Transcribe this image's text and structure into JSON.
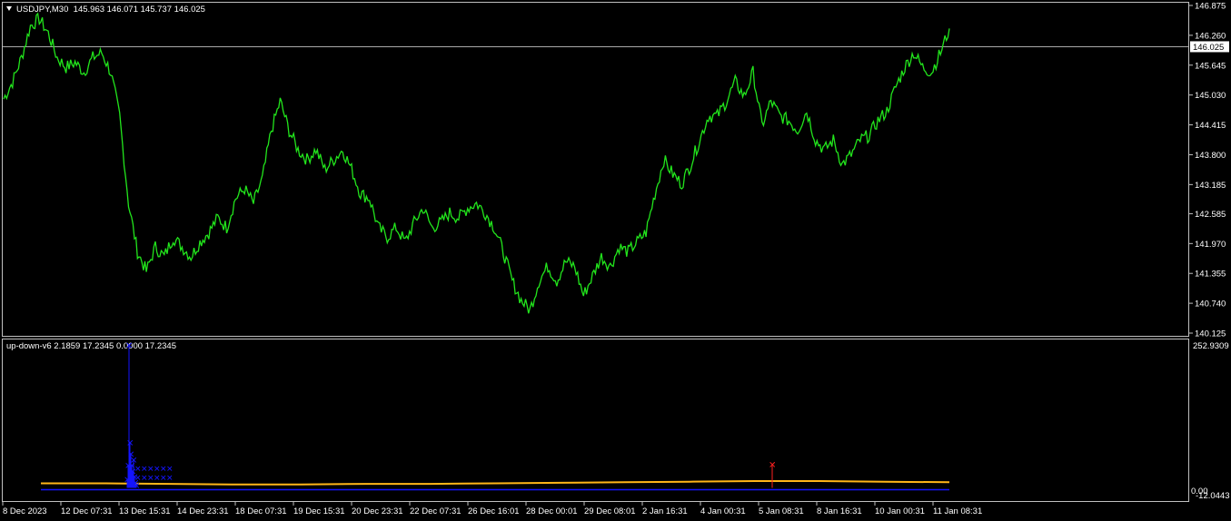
{
  "main_header": {
    "symbol": "USDJPY,M30",
    "ohlc": "145.963 146.071 145.737 146.025"
  },
  "indicator_header": {
    "name": "up-down-v6",
    "values": "2.1859 17.2345 0.0000 17.2345"
  },
  "current_price_label": "146.025",
  "indicator_scale": {
    "max_label": "252.9309",
    "low_label_a": "0.00",
    "low_label_b": "-12.0443"
  },
  "colors": {
    "price_line": "#22e51c",
    "current_price_line": "#c0c0c0",
    "blue_series": "#1414ff",
    "orange_series": "#ffb619",
    "red_series": "#ff2020",
    "grid_border": "#c0c0c0"
  },
  "chart_data": [
    {
      "type": "line",
      "symbol": "USDJPY",
      "timeframe": "M30",
      "ylim": [
        140.125,
        146.875
      ],
      "y_ticks": [
        "146.875",
        "146.260",
        "145.645",
        "145.030",
        "144.415",
        "143.800",
        "143.185",
        "142.585",
        "141.970",
        "141.355",
        "140.740",
        "140.125"
      ],
      "x_ticks": [
        "8 Dec 2023",
        "12 Dec 07:31",
        "13 Dec 15:31",
        "14 Dec 23:31",
        "18 Dec 07:31",
        "19 Dec 15:31",
        "20 Dec 23:31",
        "22 Dec 07:31",
        "26 Dec 16:01",
        "28 Dec 00:01",
        "29 Dec 08:01",
        "2 Jan 16:31",
        "4 Jan 00:31",
        "5 Jan 08:31",
        "8 Jan 16:31",
        "10 Jan 00:31",
        "11 Jan 08:31"
      ],
      "current_price": 146.025,
      "series": [
        {
          "values": [
            144.95,
            145.3,
            145.8,
            146.45,
            146.6,
            146.3,
            145.8,
            145.6,
            145.7,
            145.5,
            145.8,
            145.9,
            145.5,
            144.6,
            142.8,
            141.8,
            141.4,
            141.9,
            141.7,
            142.1,
            141.9,
            141.7,
            142.0,
            142.2,
            142.5,
            142.3,
            142.9,
            143.1,
            142.8,
            143.3,
            144.3,
            144.9,
            144.3,
            143.9,
            143.7,
            143.9,
            143.5,
            143.7,
            143.9,
            143.5,
            143.0,
            142.9,
            142.3,
            142.1,
            142.3,
            142.0,
            142.4,
            142.7,
            142.3,
            142.4,
            142.6,
            142.5,
            142.7,
            142.8,
            142.6,
            142.3,
            141.8,
            141.2,
            140.8,
            140.6,
            141.2,
            141.5,
            141.2,
            141.6,
            141.5,
            140.9,
            141.3,
            141.7,
            141.5,
            141.9,
            141.8,
            142.0,
            142.2,
            143.0,
            143.7,
            143.4,
            143.2,
            143.6,
            144.1,
            144.6,
            144.6,
            144.9,
            145.3,
            145.0,
            145.5,
            144.4,
            144.9,
            144.6,
            144.5,
            144.3,
            144.7,
            144.1,
            143.9,
            144.1,
            143.6,
            143.8,
            144.1,
            144.2,
            144.5,
            144.7,
            145.2,
            145.6,
            145.9,
            145.6,
            145.5,
            145.9,
            146.4
          ]
        }
      ]
    },
    {
      "type": "line",
      "title": "up-down-v6",
      "ylim": [
        -12.0443,
        252.9309
      ],
      "series": [
        {
          "color": "blue",
          "note_style": "spikes-and-crosses",
          "x": [
            0.12,
            0.125,
            0.13,
            0.135,
            0.14,
            0.145,
            0.15,
            0.155,
            0.16,
            0.165,
            0.17
          ],
          "values": [
            15,
            40,
            252.93,
            80,
            60,
            40,
            30,
            50,
            20,
            10,
            5
          ]
        },
        {
          "color": "orange",
          "values": [
            8,
            8,
            7,
            6,
            6,
            7,
            7,
            8,
            9,
            10,
            11,
            12,
            12,
            11,
            10
          ]
        },
        {
          "color": "red",
          "x": [
            0.64
          ],
          "values": [
            40
          ]
        }
      ]
    }
  ]
}
